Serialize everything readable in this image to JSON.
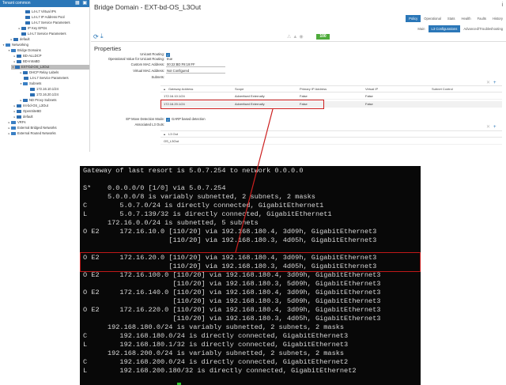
{
  "sidebar": {
    "header": "Tenant common",
    "header_icons": "▦ ▣",
    "items": [
      "L4-L7 Virtual IPs",
      "L4-L7 IP Address Pool",
      "L4-L7 Service Parameters",
      "IP Key EPGs",
      "L4-L7 Service Parameters",
      "default",
      "Networking",
      "Bridge Domains",
      "BD-ALLDCP",
      "BD-IntraBD",
      "EXT-bd-OS_L3Out",
      "DHCP Relay Labels",
      "L4-L7 Service Parameters",
      "Subnets",
      "172.16.10.1/24",
      "172.16.20.1/24",
      "ND Proxy Subnets",
      "Int-bd-OS_L3Out",
      "OpenSiteBD",
      "default",
      "VRFs",
      "External Bridged Networks",
      "External Routed Networks"
    ]
  },
  "main": {
    "title": "Bridge Domain - EXT-bd-OS_L3Out",
    "info_icon": "i",
    "tabs": [
      "Policy",
      "Operational",
      "Stats",
      "Health",
      "Faults",
      "History"
    ],
    "active_tab": "Policy",
    "subtabs": [
      "Main",
      "L3 Configurations",
      "Advanced/Troubleshooting"
    ],
    "active_subtab": "L3 Configurations",
    "health_score": "100",
    "properties_title": "Properties",
    "fields": {
      "unicast_routing_label": "Unicast Routing:",
      "op_unicast_label": "Operational Value for Unicast Routing:",
      "op_unicast_value": "true",
      "custom_mac_label": "Custom MAC Address:",
      "custom_mac_value": "00:22:BD:F8:19:FF",
      "virtual_mac_label": "Virtual MAC Address:",
      "virtual_mac_value": "Not Configured",
      "subnets_label": "Subnets:",
      "ep_move_label": "EP Move Detection Mode:",
      "ep_move_value": "GARP based detection",
      "assoc_l3out_label": "Associated L3 Outs:"
    },
    "subnets_table": {
      "columns": [
        "Gateway Address",
        "Scope",
        "Primary IP Address",
        "Virtual IP",
        "Subnet Control"
      ],
      "rows": [
        [
          "172.16.10.1/24",
          "Advertised Externally",
          "False",
          "False",
          ""
        ],
        [
          "172.16.20.1/24",
          "Advertised Externally",
          "False",
          "False",
          ""
        ]
      ]
    },
    "l3out_table": {
      "columns": [
        "L3 Out"
      ],
      "rows": [
        [
          "OS_L3Out"
        ]
      ]
    }
  },
  "terminal": {
    "lines": [
      "Gateway of last resort is 5.0.7.254 to network 0.0.0.0",
      "",
      "S*    0.0.0.0/0 [1/0] via 5.0.7.254",
      "      5.0.0.0/8 is variably subnetted, 2 subnets, 2 masks",
      "C        5.0.7.0/24 is directly connected, GigabitEthernet1",
      "L        5.0.7.139/32 is directly connected, GigabitEthernet1",
      "      172.16.0.0/24 is subnetted, 5 subnets",
      "O E2     172.16.10.0 [110/20] via 192.168.180.4, 3d09h, GigabitEthernet3",
      "                     [110/20] via 192.168.180.3, 4d05h, GigabitEthernet3",
      "O E2     172.16.20.0 [110/20] via 192.168.180.4, 3d09h, GigabitEthernet3",
      "                     [110/20] via 192.168.180.3, 4d05h, GigabitEthernet3",
      "O E2     172.16.100.0 [110/20] via 192.168.180.4, 3d09h, GigabitEthernet3",
      "                      [110/20] via 192.168.180.3, 5d09h, GigabitEthernet3",
      "O E2     172.16.140.0 [110/20] via 192.168.180.4, 3d09h, GigabitEthernet3",
      "                      [110/20] via 192.168.180.3, 5d09h, GigabitEthernet3",
      "O E2     172.16.220.0 [110/20] via 192.168.180.4, 3d09h, GigabitEthernet3",
      "                      [110/20] via 192.168.180.3, 4d05h, GigabitEthernet3",
      "      192.168.180.0/24 is variably subnetted, 2 subnets, 2 masks",
      "C        192.168.180.0/24 is directly connected, GigabitEthernet3",
      "L        192.168.180.1/32 is directly connected, GigabitEthernet3",
      "      192.168.200.0/24 is variably subnetted, 2 subnets, 2 masks",
      "C        192.168.200.0/24 is directly connected, GigabitEthernet2",
      "L        192.168.200.180/32 is directly connected, GigabitEthernet2"
    ]
  },
  "colors": {
    "accent": "#2b77b8",
    "health": "#4eab3b",
    "highlight": "#cc1f1f",
    "terminal_bg": "#080808",
    "terminal_fg": "#d8d8d8"
  }
}
